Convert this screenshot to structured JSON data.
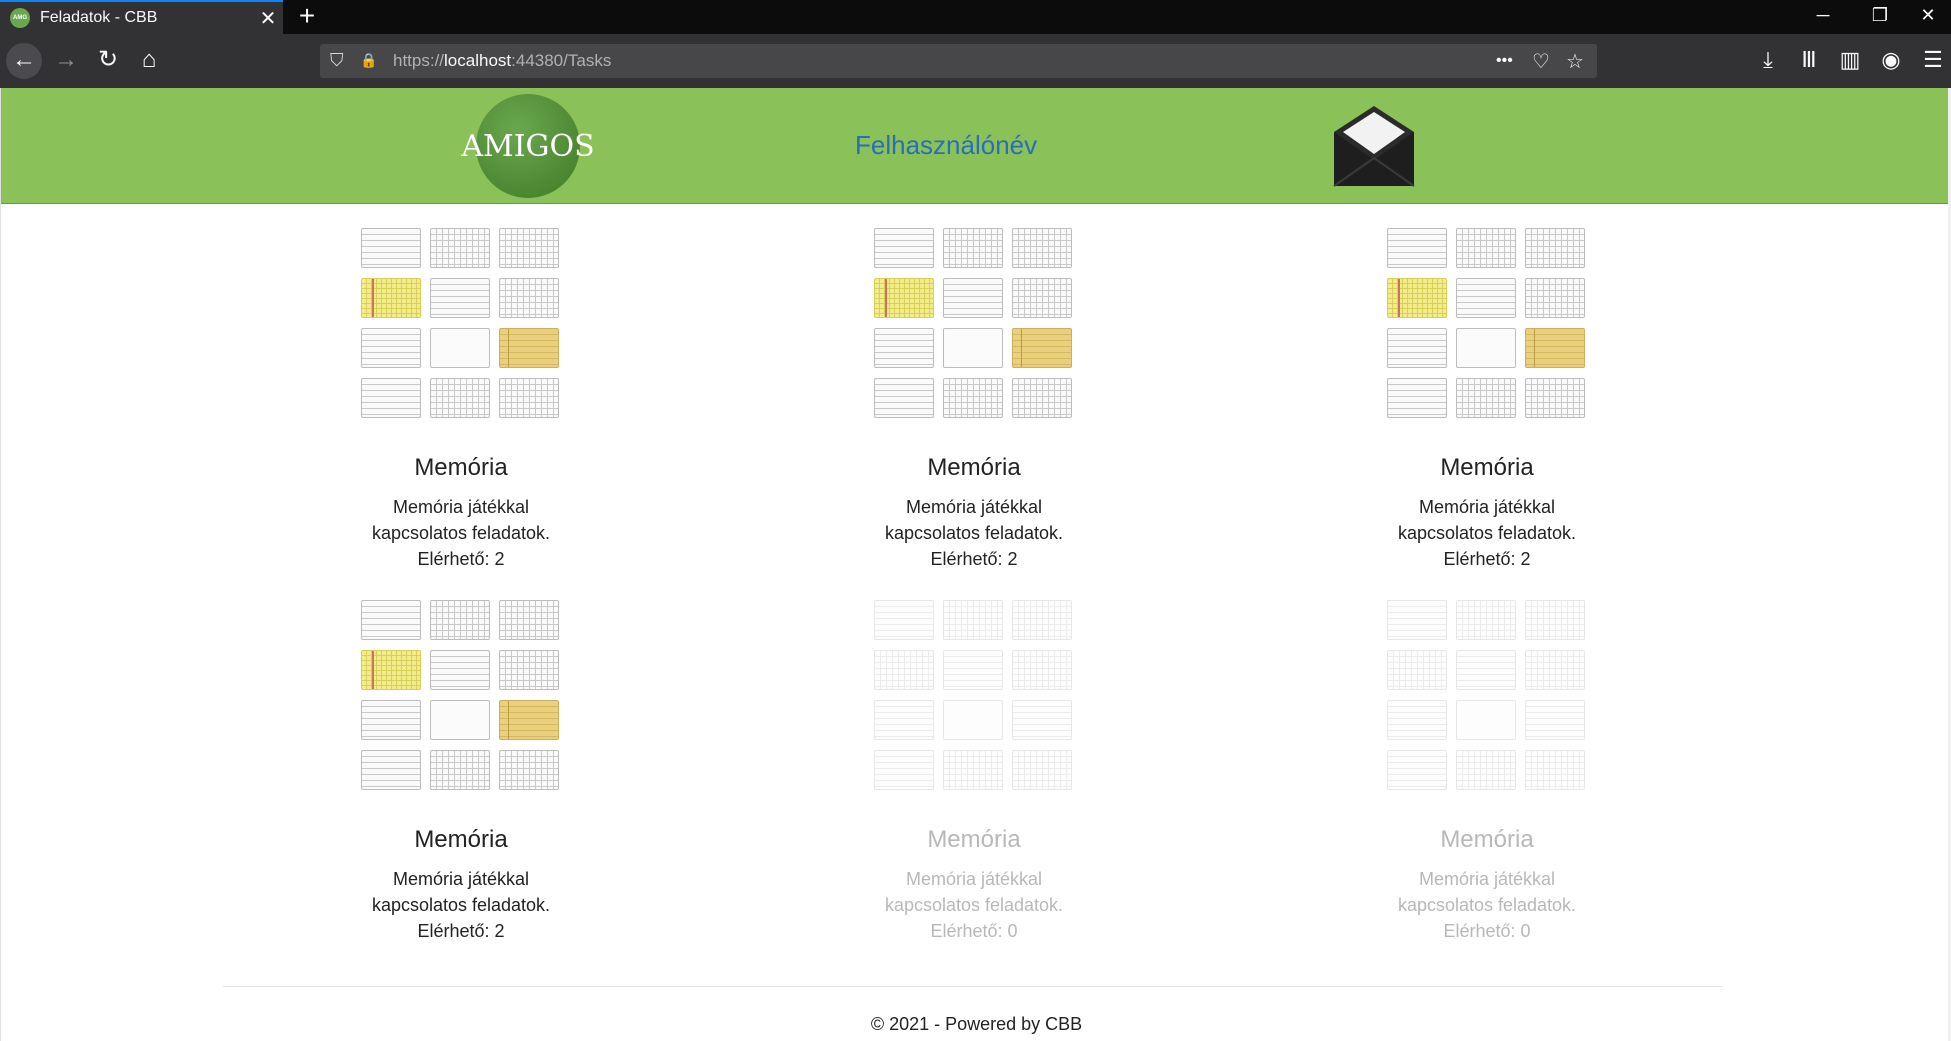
{
  "browser": {
    "tab_title": "Feladatok - CBB",
    "tab_favicon": "AMG",
    "tab_close": "✕",
    "new_tab": "+",
    "url_scheme": "https://",
    "url_host": "localhost",
    "url_rest": ":44380/Tasks",
    "window": {
      "minimize": "─",
      "restore": "❐",
      "close": "✕"
    },
    "icons": {
      "back": "←",
      "forward": "→",
      "reload": "↻",
      "home": "⌂",
      "shield": "⛉",
      "lock": "🔒",
      "more": "•••",
      "pocket": "♡",
      "star": "☆",
      "download": "⤓",
      "library": "Ⅲ",
      "sidebar": "▥",
      "account": "◉",
      "menu": "☰"
    }
  },
  "header": {
    "logo_text": "AMIGOS",
    "username": "Felhasználónév",
    "mail_icon": "envelope-icon"
  },
  "cards": [
    {
      "title": "Memória",
      "desc_line1": "Memória játékkal",
      "desc_line2": "kapcsolatos feladatok.",
      "available": "Elérhető: 2",
      "enabled": true
    },
    {
      "title": "Memória",
      "desc_line1": "Memória játékkal",
      "desc_line2": "kapcsolatos feladatok.",
      "available": "Elérhető: 2",
      "enabled": true
    },
    {
      "title": "Memória",
      "desc_line1": "Memória játékkal",
      "desc_line2": "kapcsolatos feladatok.",
      "available": "Elérhető: 2",
      "enabled": true
    },
    {
      "title": "Memória",
      "desc_line1": "Memória játékkal",
      "desc_line2": "kapcsolatos feladatok.",
      "available": "Elérhető: 2",
      "enabled": true
    },
    {
      "title": "Memória",
      "desc_line1": "Memória játékkal",
      "desc_line2": "kapcsolatos feladatok.",
      "available": "Elérhető: 0",
      "enabled": false
    },
    {
      "title": "Memória",
      "desc_line1": "Memória játékkal",
      "desc_line2": "kapcsolatos feladatok.",
      "available": "Elérhető: 0",
      "enabled": false
    }
  ],
  "footer": {
    "text": "© 2021 - Powered by CBB"
  },
  "colors": {
    "header_bg": "#8bc159",
    "username": "#2a6ebb",
    "disabled_text": "#b8b8b8"
  }
}
